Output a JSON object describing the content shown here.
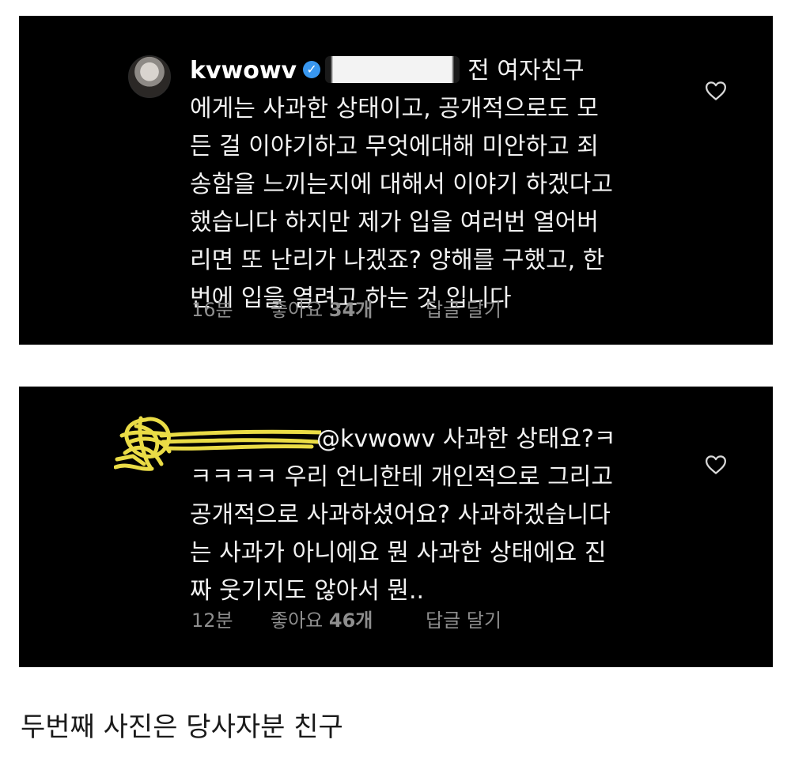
{
  "comments": [
    {
      "username": "kvwowv",
      "verified_glyph": "✓",
      "lines": [
        "전 여자친구",
        "에게는 사과한 상태이고, 공개적으로도 모",
        "든 걸 이야기하고 무엇에대해 미안하고 죄",
        "송함을 느끼는지에 대해서 이야기 하겠다고",
        "했습니다 하지만 제가 입을 여러번 열어버",
        "리면 또 난리가 나겠죠? 양해를 구했고, 한",
        "번에 입을 열려고 하는 것 입니다"
      ],
      "time": "16분",
      "likes_label": "좋아요",
      "likes_count": "34개",
      "reply_label": "답글 달기"
    },
    {
      "mention": "@kvwowv",
      "lines": [
        "사과한 상태요?ㅋ",
        "ㅋㅋㅋㅋ 우리 언니한테 개인적으로 그리고",
        "공개적으로 사과하셨어요? 사과하겠습니다",
        "는 사과가 아니에요 뭔 사과한 상태에요 진",
        "짜 웃기지도 않아서 뭔.."
      ],
      "time": "12분",
      "likes_label": "좋아요",
      "likes_count": "46개",
      "reply_label": "답글 달기"
    }
  ],
  "caption": "두번째 사진은 당사자분 친구",
  "colors": {
    "background": "#000000",
    "text": "#f2f2f2",
    "meta": "#8e8e8e",
    "verified": "#3897f0",
    "redaction": "#f7e84a"
  }
}
